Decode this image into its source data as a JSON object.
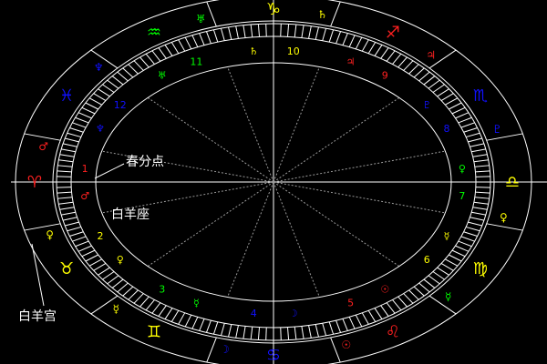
{
  "labels": {
    "vernal_equinox": "春分点",
    "aries_constellation": "白羊座",
    "aries_house": "白羊宫"
  },
  "colors": {
    "background": "#000000",
    "lines": "#ffffff",
    "fire": "#ff2020",
    "earth": "#ffff00",
    "air": "#00ff00",
    "water": "#1010ff"
  },
  "signs": [
    {
      "name": "aries-sign",
      "glyph": "♈",
      "color": "#ff2020"
    },
    {
      "name": "taurus-sign",
      "glyph": "♉",
      "color": "#ffff00"
    },
    {
      "name": "gemini-sign",
      "glyph": "♊",
      "color": "#ffff00"
    },
    {
      "name": "cancer-sign",
      "glyph": "♋",
      "color": "#1010ff"
    },
    {
      "name": "leo-sign",
      "glyph": "♌",
      "color": "#ff2020"
    },
    {
      "name": "virgo-sign",
      "glyph": "♍",
      "color": "#ffff00"
    },
    {
      "name": "libra-sign",
      "glyph": "♎",
      "color": "#ffff00"
    },
    {
      "name": "scorpio-sign",
      "glyph": "♏",
      "color": "#1010ff"
    },
    {
      "name": "sagittarius-sign",
      "glyph": "♐",
      "color": "#ff2020"
    },
    {
      "name": "capricorn-sign",
      "glyph": "♑",
      "color": "#ffff00"
    },
    {
      "name": "aquarius-sign",
      "glyph": "♒",
      "color": "#00ff00"
    },
    {
      "name": "pisces-sign",
      "glyph": "♓",
      "color": "#1010ff"
    }
  ],
  "outer_rulers": [
    {
      "name": "mars-icon",
      "glyph": "♂",
      "color": "#ff2020"
    },
    {
      "name": "venus-icon",
      "glyph": "♀",
      "color": "#ffff00"
    },
    {
      "name": "mercury-icon",
      "glyph": "☿",
      "color": "#ffff00"
    },
    {
      "name": "moon-icon",
      "glyph": "☽",
      "color": "#1010ff"
    },
    {
      "name": "sun-icon",
      "glyph": "☉",
      "color": "#ff2020"
    },
    {
      "name": "mercury-icon",
      "glyph": "☿",
      "color": "#00ff00"
    },
    {
      "name": "venus-icon",
      "glyph": "♀",
      "color": "#ffff00"
    },
    {
      "name": "pluto-icon",
      "glyph": "♇",
      "color": "#1010ff"
    },
    {
      "name": "jupiter-icon",
      "glyph": "♃",
      "color": "#ff2020"
    },
    {
      "name": "saturn-icon",
      "glyph": "♄",
      "color": "#ffff00"
    },
    {
      "name": "uranus-icon",
      "glyph": "♅",
      "color": "#00ff00"
    },
    {
      "name": "neptune-icon",
      "glyph": "♆",
      "color": "#1010ff"
    }
  ],
  "houses": [
    {
      "num": "1",
      "glyph": "♂",
      "color": "#ff2020"
    },
    {
      "num": "2",
      "glyph": "♀",
      "color": "#ffff00"
    },
    {
      "num": "3",
      "glyph": "☿",
      "color": "#00ff00"
    },
    {
      "num": "4",
      "glyph": "☽",
      "color": "#1010ff"
    },
    {
      "num": "5",
      "glyph": "☉",
      "color": "#ff2020"
    },
    {
      "num": "6",
      "glyph": "☿",
      "color": "#ffff00"
    },
    {
      "num": "7",
      "glyph": "♀",
      "color": "#00ff00"
    },
    {
      "num": "8",
      "glyph": "♇",
      "color": "#1010ff"
    },
    {
      "num": "9",
      "glyph": "♃",
      "color": "#ff2020"
    },
    {
      "num": "10",
      "glyph": "♄",
      "color": "#ffff00"
    },
    {
      "num": "11",
      "glyph": "♅",
      "color": "#00ff00"
    },
    {
      "num": "12",
      "glyph": "♆",
      "color": "#1010ff"
    }
  ]
}
